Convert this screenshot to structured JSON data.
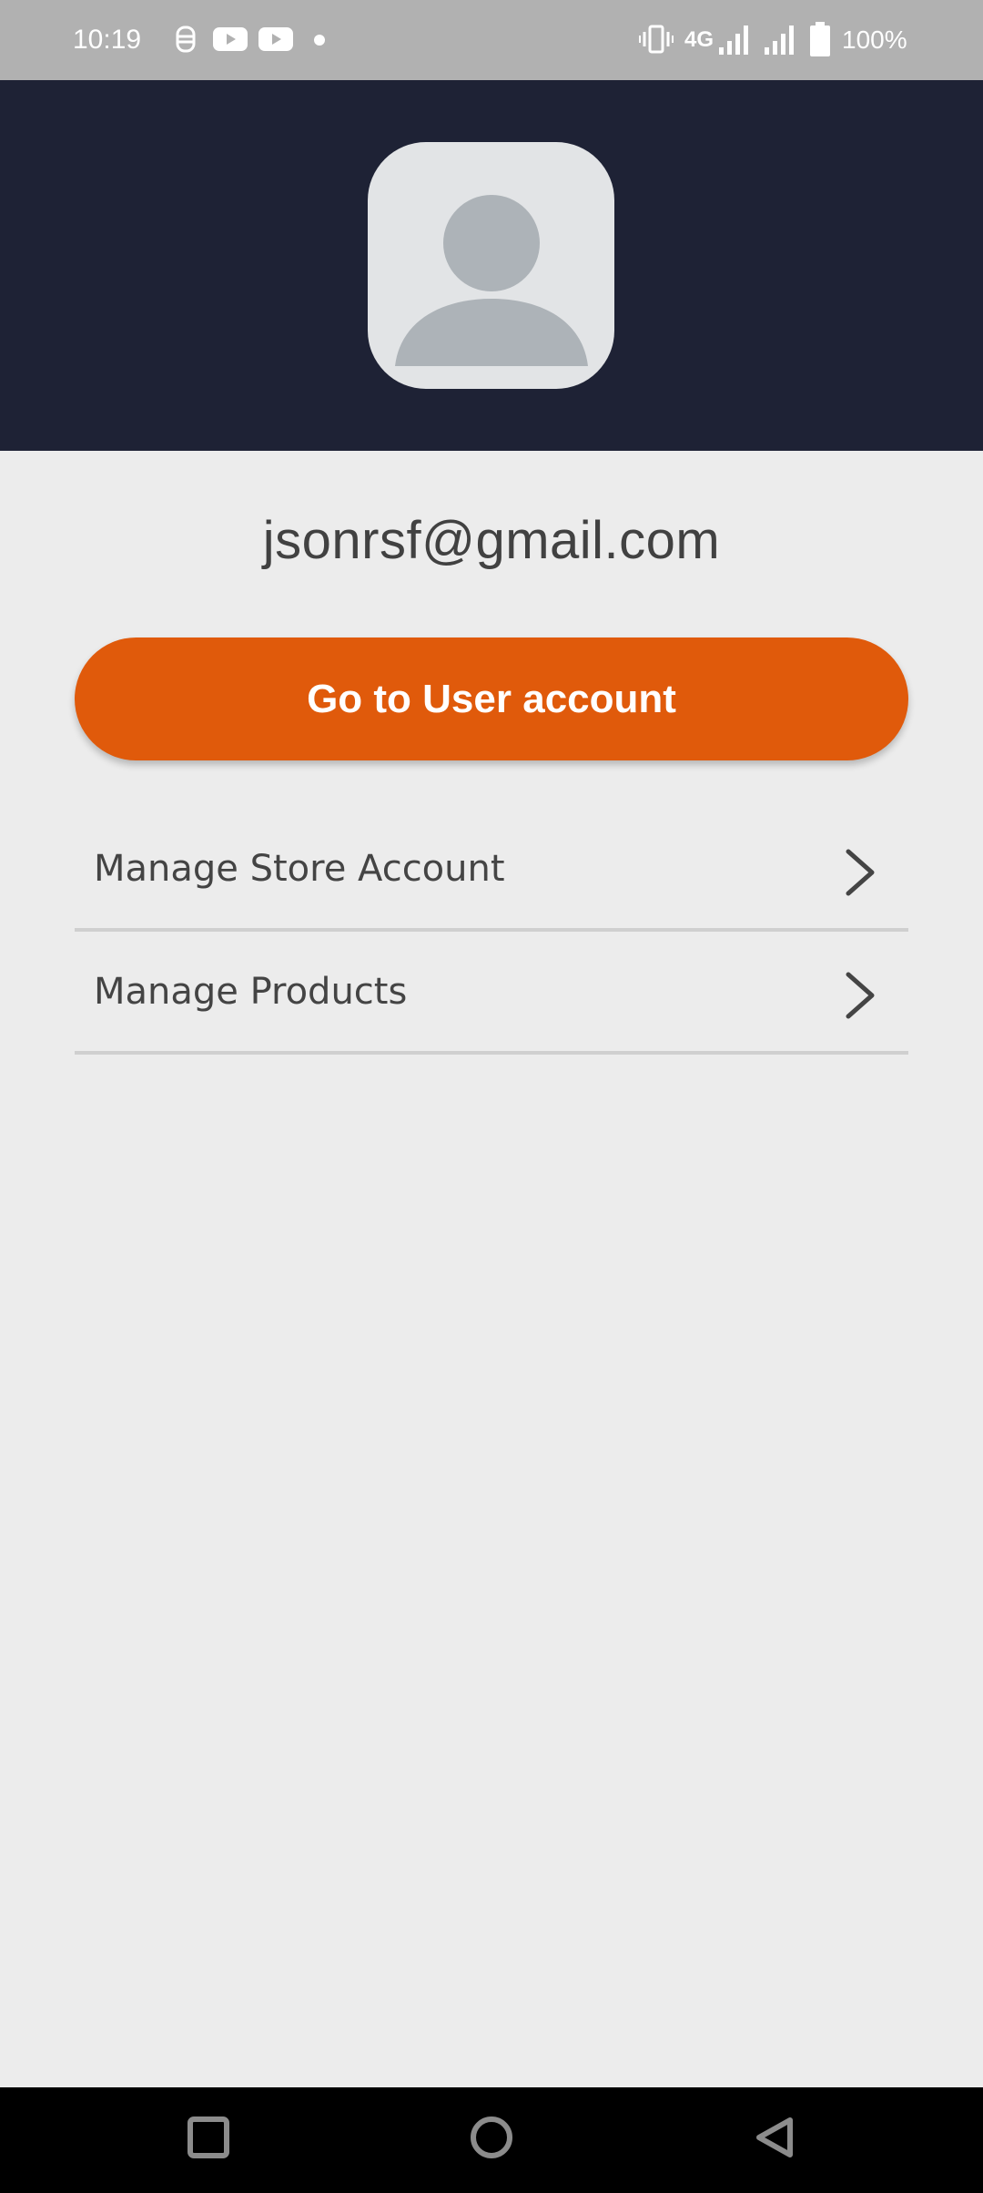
{
  "status_bar": {
    "time": "10:19",
    "network": "4G",
    "battery": "100%",
    "notification_icons": [
      "gmail-like-icon",
      "youtube-icon",
      "youtube-icon",
      "dot-icon"
    ],
    "system_icons": [
      "vibrate-icon",
      "signal-icon",
      "signal-icon",
      "battery-icon"
    ]
  },
  "profile": {
    "email": "jsonrsf@gmail.com"
  },
  "primary_action": {
    "label": "Go to User account"
  },
  "menu": {
    "items": [
      {
        "label": "Manage Store Account",
        "icon": "chevron-right-icon"
      },
      {
        "label": "Manage Products",
        "icon": "chevron-right-icon"
      }
    ]
  },
  "nav_bar": {
    "buttons": [
      "recent-apps-icon",
      "home-icon",
      "back-icon"
    ]
  },
  "colors": {
    "header_bg": "#1e2235",
    "accent": "#e05a0b",
    "page_bg": "#ececec"
  }
}
